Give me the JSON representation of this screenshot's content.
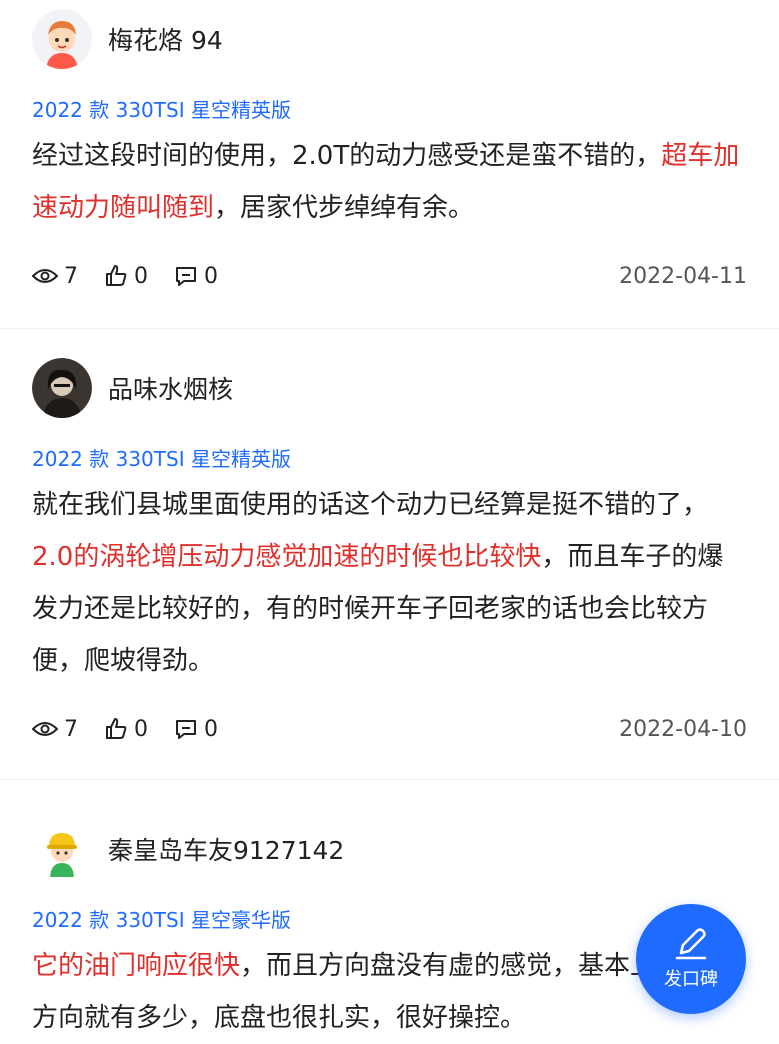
{
  "reviews": [
    {
      "username": "梅花烙 94",
      "trim": "2022 款 330TSI 星空精英版",
      "segments": [
        {
          "text": "经过这段时间的使用，2.0T的动力感受还是蛮不错的，",
          "hl": false
        },
        {
          "text": "超车加速动力随叫随到",
          "hl": true
        },
        {
          "text": "，居家代步绰绰有余。",
          "hl": false
        }
      ],
      "views": "7",
      "likes": "0",
      "comments": "0",
      "date": "2022-04-11"
    },
    {
      "username": "品味水烟核",
      "trim": "2022 款 330TSI 星空精英版",
      "segments": [
        {
          "text": "就在我们县城里面使用的话这个动力已经算是挺不错的了，",
          "hl": false
        },
        {
          "text": "2.0的涡轮增压动力感觉加速的时候也比较快",
          "hl": true
        },
        {
          "text": "，而且车子的爆发力还是比较好的，有的时候开车子回老家的话也会比较方便，爬坡得劲。",
          "hl": false
        }
      ],
      "views": "7",
      "likes": "0",
      "comments": "0",
      "date": "2022-04-10"
    },
    {
      "username": "秦皇岛车友9127142",
      "trim": "2022 款 330TSI 星空豪华版",
      "segments": [
        {
          "text": "它的油门响应很快",
          "hl": true
        },
        {
          "text": "，而且方向盘没有虚的感觉，基本上打多少方向就有多少，底盘也很扎实，很好操控。",
          "hl": false
        }
      ]
    }
  ],
  "fab": {
    "label": "发口碑",
    "icon": "pen-icon"
  },
  "colors": {
    "accent": "#1f6bff",
    "highlight": "#e0302c"
  }
}
